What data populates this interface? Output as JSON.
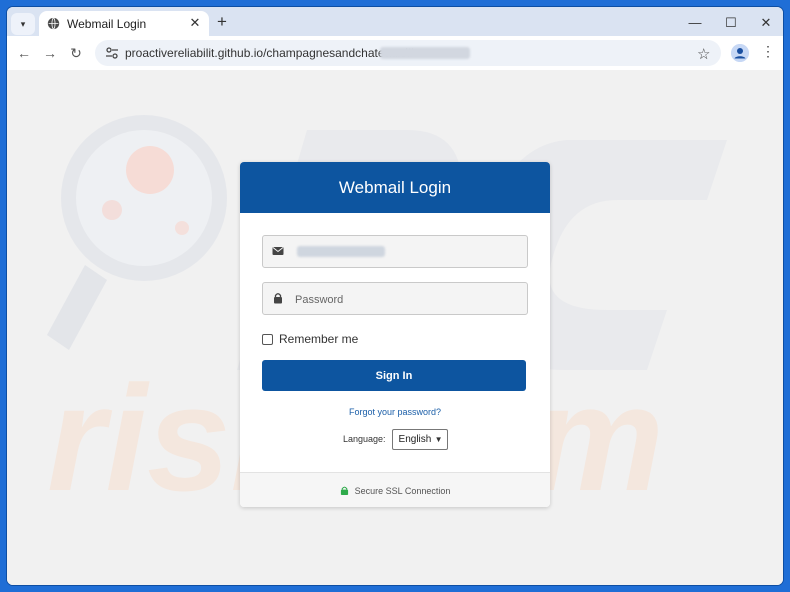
{
  "browser": {
    "tab": {
      "title": "Webmail Login",
      "close_glyph": "✕"
    },
    "new_tab_glyph": "+",
    "window_controls": {
      "minimize": "—",
      "maximize": "☐",
      "close": "✕"
    },
    "nav": {
      "back": "←",
      "forward": "→",
      "reload": "↻"
    },
    "address_bar": {
      "url": "proactivereliabilit.github.io/champagnesandchateaux/#"
    },
    "bookmark_glyph": "☆",
    "menu_glyph": "⋮"
  },
  "login": {
    "header": "Webmail Login",
    "email_field": {
      "placeholder": ""
    },
    "password_field": {
      "placeholder": "Password"
    },
    "remember_label": "Remember me",
    "submit_label": "Sign In",
    "forgot_link": "Forgot your password?",
    "language_label": "Language:",
    "language_selected": "English",
    "footer_text": "Secure SSL Connection"
  },
  "colors": {
    "primary": "#0d55a0",
    "ssl_lock": "#2eaa4a",
    "window_frame": "#1f6ed6"
  },
  "icons": [
    "tab-search-icon",
    "globe-icon",
    "close-icon",
    "plus-icon",
    "back-icon",
    "forward-icon",
    "reload-icon",
    "site-info-icon",
    "star-icon",
    "profile-icon",
    "menu-icon",
    "envelope-icon",
    "lock-icon",
    "chevron-down-icon",
    "ssl-lock-icon"
  ]
}
